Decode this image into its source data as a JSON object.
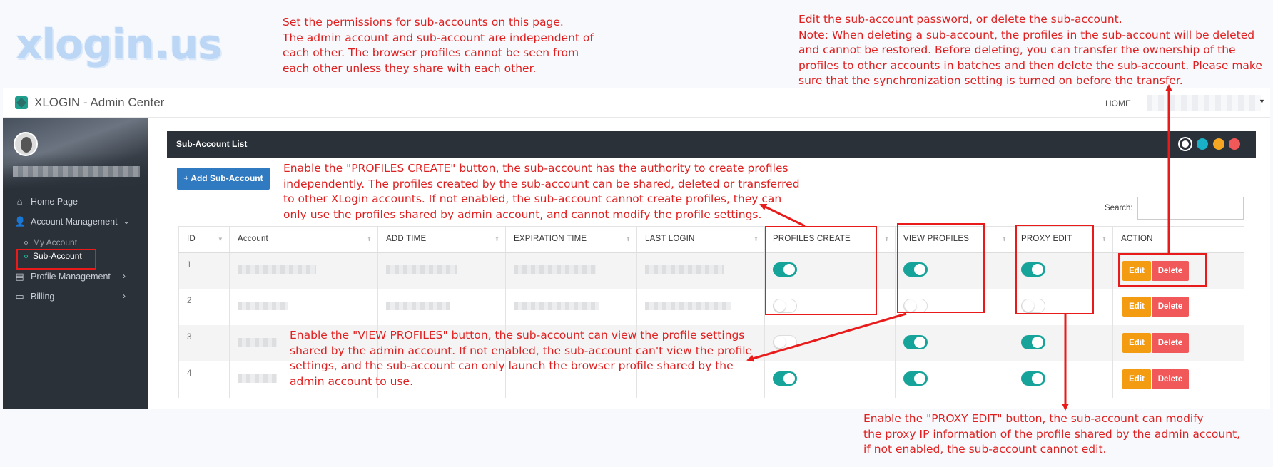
{
  "watermark": "xlogin.us",
  "annotations": {
    "top_left": "Set the permissions for sub-accounts on this page.\nThe admin account and sub-account are independent of\neach other. The browser profiles cannot be seen from\neach other unless they share with each other.",
    "top_right": "Edit the sub-account password, or delete the sub-account.\nNote: When deleting a sub-account, the profiles in the sub-account will be deleted\nand cannot be restored. Before deleting, you can transfer the ownership of the\nprofiles to other accounts in batches and then delete the sub-account. Please make\nsure that the synchronization setting is turned on before the transfer.",
    "profiles_create": "Enable the \"PROFILES CREATE\" button, the sub-account has the authority to create profiles\nindependently. The profiles created by the sub-account can be shared, deleted or transferred\nto other XLogin accounts. If not enabled, the sub-account cannot create profiles, they can\nonly use the profiles shared by admin account, and cannot modify the profile settings.",
    "view_profiles": "Enable the \"VIEW PROFILES\" button, the sub-account can view the profile settings\nshared by the admin account. If not enabled, the sub-account can't view the profile\nsettings, and the sub-account can only launch the browser profile shared by the\nadmin account to use.",
    "proxy_edit": "Enable the \"PROXY EDIT\" button, the sub-account can modify\nthe proxy IP information of the profile shared by the admin account,\nif not enabled, the sub-account cannot edit."
  },
  "header": {
    "brand": "XLOGIN - Admin Center",
    "home": "HOME"
  },
  "sidebar": {
    "items": [
      {
        "label": "Home Page",
        "icon": "home-icon"
      },
      {
        "label": "Account Management",
        "icon": "user-plus-icon"
      },
      {
        "label": "Profile Management",
        "icon": "file-icon"
      },
      {
        "label": "Billing",
        "icon": "billing-icon"
      }
    ],
    "sub_items": [
      {
        "label": "My Account"
      },
      {
        "label": "Sub-Account",
        "active": true
      }
    ]
  },
  "panel": {
    "title": "Sub-Account List",
    "add_button": "+ Add Sub-Account",
    "search_label": "Search:",
    "search_value": ""
  },
  "table": {
    "columns": [
      "ID",
      "Account",
      "ADD TIME",
      "EXPIRATION TIME",
      "LAST LOGIN",
      "PROFILES CREATE",
      "VIEW PROFILES",
      "PROXY EDIT",
      "ACTION"
    ],
    "rows": [
      {
        "id": "1",
        "profiles_create": true,
        "view_profiles": true,
        "proxy_edit": true
      },
      {
        "id": "2",
        "profiles_create": false,
        "view_profiles": false,
        "proxy_edit": false
      },
      {
        "id": "3",
        "profiles_create": false,
        "view_profiles": true,
        "proxy_edit": true
      },
      {
        "id": "4",
        "profiles_create": true,
        "view_profiles": true,
        "proxy_edit": true
      }
    ],
    "edit_label": "Edit",
    "delete_label": "Delete"
  },
  "colors": {
    "annotation": "#e02020",
    "toggle_on": "#16a39a",
    "edit": "#f39c12",
    "delete": "#f0585a",
    "primary": "#2f7ac0",
    "sidebar": "#2b3139"
  }
}
